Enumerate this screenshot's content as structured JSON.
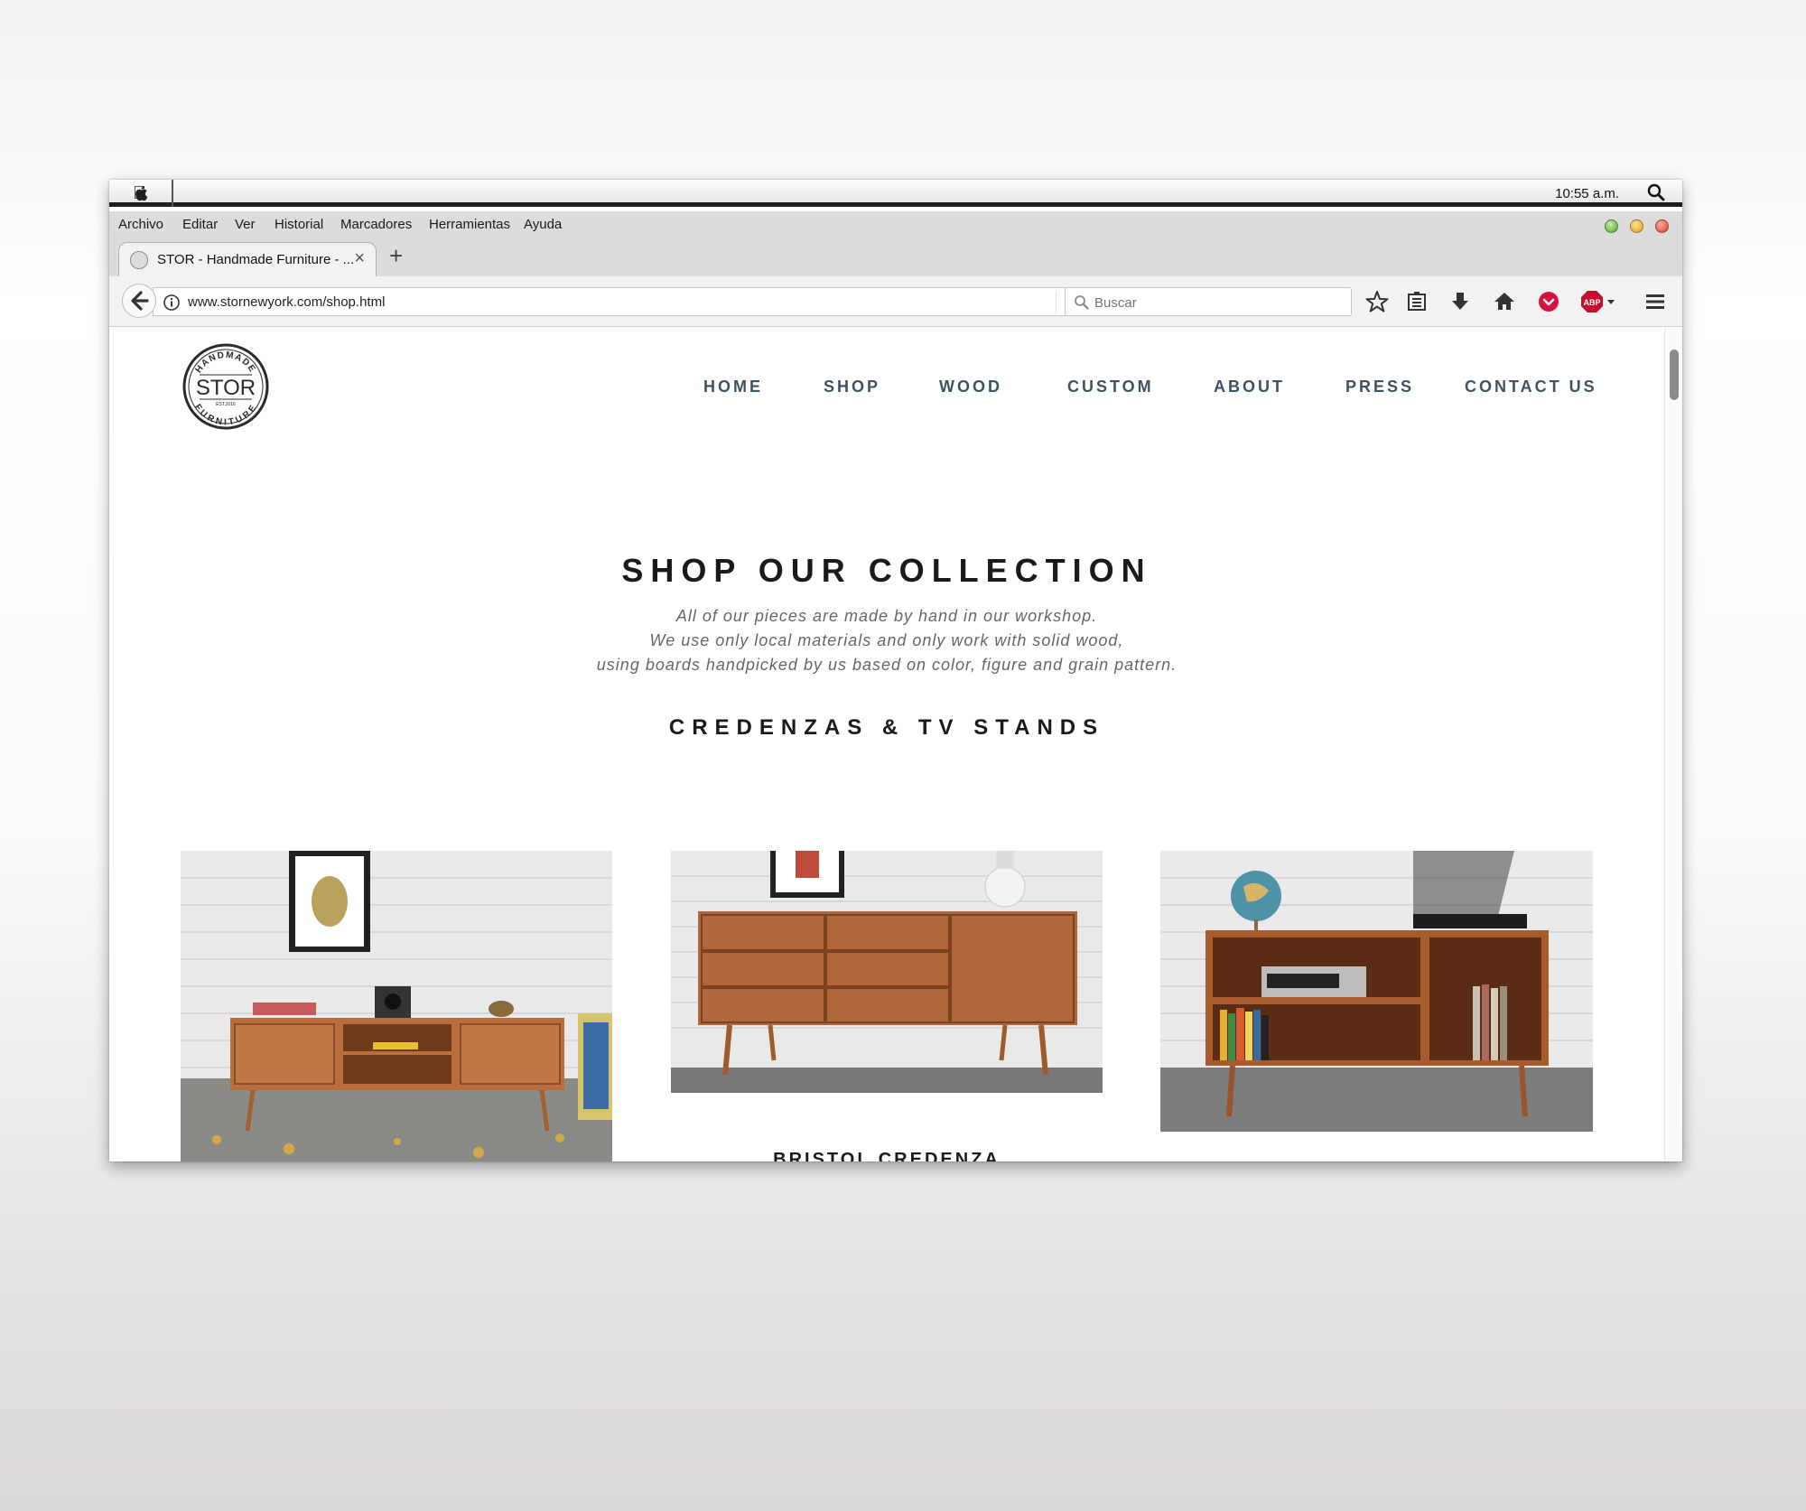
{
  "os": {
    "clock": "10:55 a.m."
  },
  "menubar": {
    "items": [
      "Archivo",
      "Editar",
      "Ver",
      "Historial",
      "Marcadores",
      "Herramientas",
      "Ayuda"
    ]
  },
  "tab": {
    "title": "STOR - Handmade Furniture - ..."
  },
  "navbar": {
    "url": "www.stornewyork.com/shop.html",
    "search_placeholder": "Buscar"
  },
  "site": {
    "logo": {
      "name": "STOR",
      "top_text": "HANDMADE",
      "bottom_text": "FURNITURE",
      "est": "EST.2016"
    },
    "nav": [
      "HOME",
      "SHOP",
      "WOOD",
      "CUSTOM",
      "ABOUT",
      "PRESS",
      "CONTACT US"
    ],
    "title": "SHOP OUR COLLECTION",
    "tagline": [
      "All of our pieces are made by hand in our workshop.",
      "We use only local materials and only work with solid wood,",
      "using boards handpicked by us based on color, figure and grain pattern."
    ],
    "section_title": "CREDENZAS & TV STANDS",
    "products": [
      {
        "name": ""
      },
      {
        "name": "BRISTOL CREDENZA"
      },
      {
        "name": ""
      }
    ]
  },
  "colors": {
    "nav_text": "#3d5360",
    "wood": "#b66a3a",
    "menubar": "#dcdcdc"
  }
}
